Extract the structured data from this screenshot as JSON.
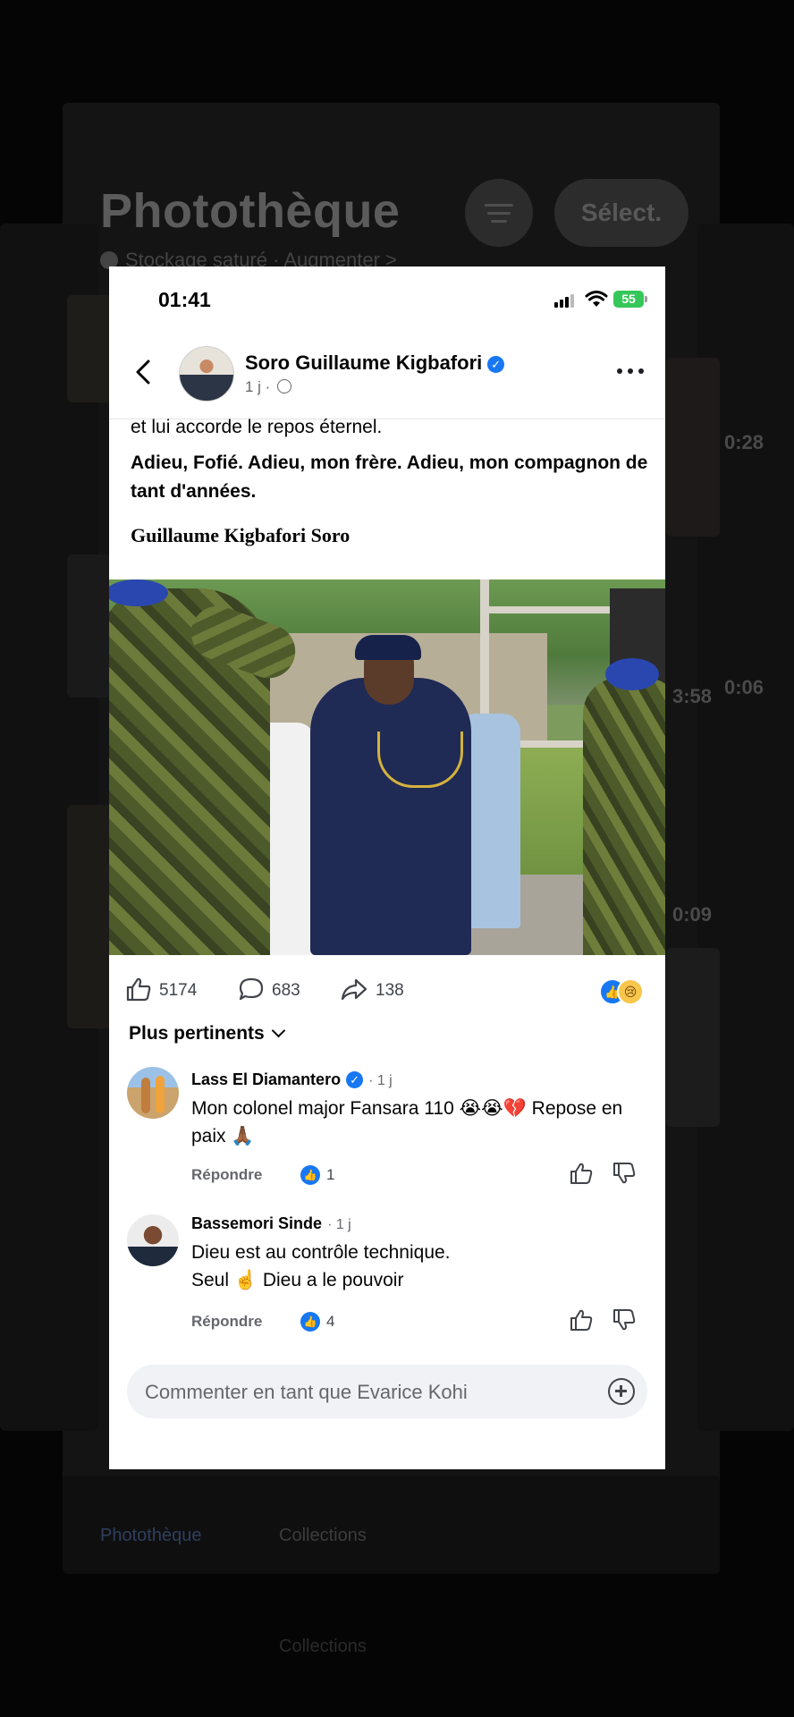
{
  "background_app": {
    "title": "Photothèque",
    "subtitle": "Stockage saturé · Augmenter >",
    "select_label": "Sélect.",
    "tabs": [
      "Photothèque",
      "Collections"
    ],
    "thumbnail_times": [
      "0:28",
      "3:58",
      "0:06",
      "0:09"
    ]
  },
  "status_bar": {
    "time": "01:41",
    "battery": "55"
  },
  "post": {
    "author": "Soro Guillaume Kigbafori",
    "age": "1 j ·",
    "text_partial": "et lui accorde le repos éternel.",
    "text_bold": "Adieu, Fofié. Adieu, mon frère. Adieu, mon compagnon de tant d'années.",
    "signature": "Guillaume Kigbafori Soro",
    "likes": "5174",
    "comments": "683",
    "shares": "138",
    "sort_label": "Plus pertinents"
  },
  "comments": [
    {
      "author": "Lass El Diamantero",
      "time": "· 1 j",
      "text": "Mon colonel major Fansara 110 😭😭💔 Repose en paix 🙏🏾",
      "reply_label": "Répondre",
      "likes": "1"
    },
    {
      "author": "Bassemori Sinde",
      "time": "· 1 j",
      "text_line1": "Dieu est au contrôle technique.",
      "text_line2": "Seul ☝️ Dieu a le pouvoir",
      "reply_label": "Répondre",
      "likes": "4"
    }
  ],
  "comment_input": {
    "placeholder": "Commenter en tant que Evarice Kohi"
  },
  "colors": {
    "facebook_blue": "#1877f2",
    "battery_green": "#34c759"
  }
}
